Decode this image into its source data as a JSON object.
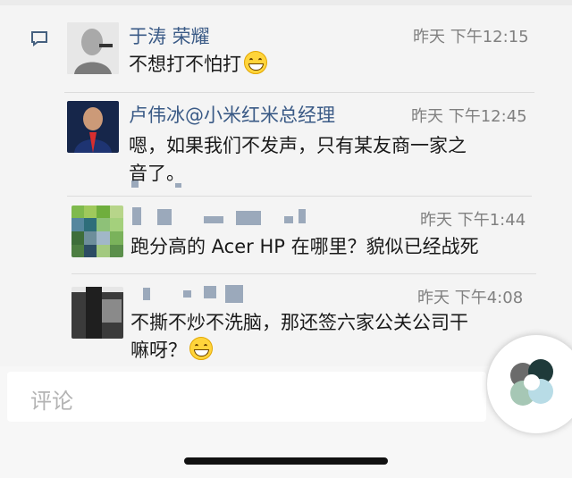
{
  "comments": [
    {
      "name": "于涛 荣耀",
      "time": "昨天 下午12:15",
      "text": "不想打不怕打",
      "emoji": "grinning-face"
    },
    {
      "name": "卢伟冰@小米红米总经理",
      "time": "昨天 下午12:45",
      "text_lines": [
        "嗯，如果我们不发声，只有某友商一家之",
        "音了。"
      ]
    },
    {
      "name": "",
      "time": "昨天 下午1:44",
      "text": "跑分高的 Acer HP 在哪里？貌似已经战死"
    },
    {
      "name": "",
      "time": "昨天 下午4:08",
      "text_lines": [
        "不撕不炒不洗脑，那还签六家公关公司干",
        "嘛呀？"
      ],
      "emoji": "grinning-face"
    }
  ],
  "input": {
    "placeholder": "评论"
  },
  "icons": {
    "comment": "comment-bubble-icon",
    "emoji": "grinning-face-emoji-icon",
    "floating": "app-shortcut-icon"
  },
  "colors": {
    "name": "#3a5a86",
    "time": "#808080",
    "text": "#1a1a1a",
    "background": "#f4f4f4"
  }
}
